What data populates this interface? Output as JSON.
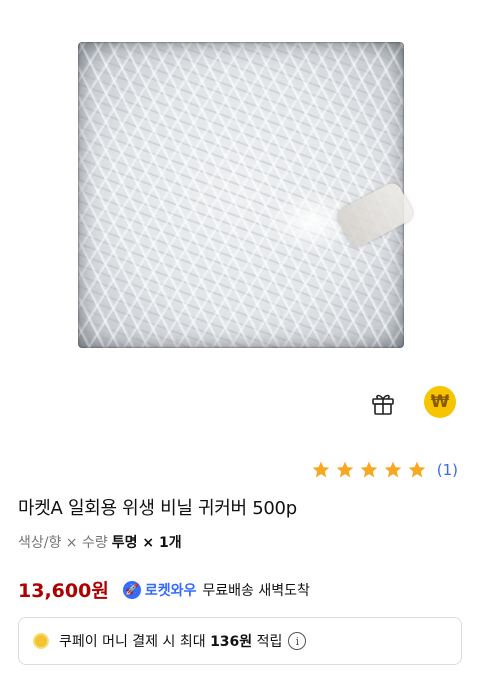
{
  "product": {
    "title": "마켓A 일회용 위생 비닐 귀커버 500p",
    "rating": 5,
    "review_count": "(1)"
  },
  "options": {
    "label": "색상/향 × 수량",
    "value": "투명 × 1개"
  },
  "price": {
    "amount": "13,600원",
    "rocket_label": "로켓와우",
    "delivery": "무료배송 새벽도착"
  },
  "cash": {
    "prefix": "쿠페이 머니 결제 시 최대",
    "amount": "136원",
    "suffix": "적립"
  },
  "icons": {
    "gift": "gift-icon",
    "won": "won-coin-icon",
    "info": "info-icon",
    "coin": "coin-icon"
  },
  "colors": {
    "price": "#ae0000",
    "rocket": "#346aff",
    "star": "#f7a823",
    "won_badge": "#f7c400"
  }
}
